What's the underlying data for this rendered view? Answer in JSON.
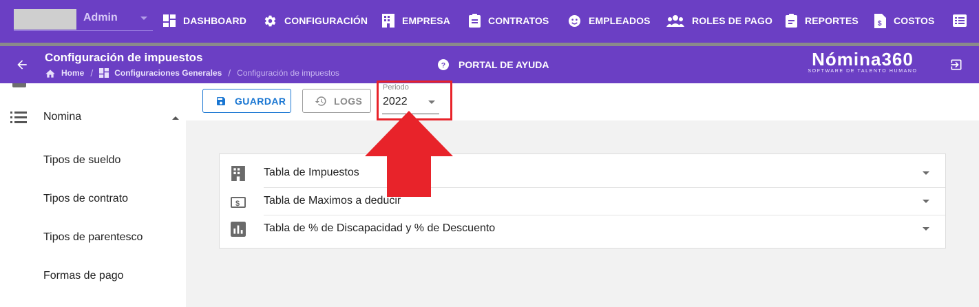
{
  "topbar": {
    "user_label": "Admin",
    "nav": [
      {
        "label": "DASHBOARD",
        "icon": "dashboard-icon"
      },
      {
        "label": "CONFIGURACIÓN",
        "icon": "gear-icon"
      },
      {
        "label": "EMPRESA",
        "icon": "building-icon"
      },
      {
        "label": "CONTRATOS",
        "icon": "clipboard-icon"
      },
      {
        "label": "EMPLEADOS",
        "icon": "face-icon"
      },
      {
        "label": "ROLES DE PAGO",
        "icon": "people-icon"
      },
      {
        "label": "REPORTES",
        "icon": "report-icon"
      },
      {
        "label": "COSTOS",
        "icon": "cost-file-icon"
      }
    ]
  },
  "header": {
    "title": "Configuración de impuestos",
    "breadcrumb": [
      "Home",
      "Configuraciones Generales",
      "Configuración de impuestos"
    ],
    "help_label": "PORTAL DE AYUDA",
    "brand_name": "Nómina360",
    "brand_tagline": "SOFTWARE DE TALENTO HUMANO"
  },
  "sidebar": {
    "group_label": "Nomina",
    "items": [
      "Tipos de sueldo",
      "Tipos de contrato",
      "Tipos de parentesco",
      "Formas de pago"
    ]
  },
  "toolbar": {
    "save_label": "GUARDAR",
    "logs_label": "LOGS",
    "period_label": "Periodo",
    "period_value": "2022"
  },
  "panels": [
    {
      "label": "Tabla de Impuestos",
      "icon": "building-icon"
    },
    {
      "label": "Tabla de Maximos a deducir",
      "icon": "money-icon"
    },
    {
      "label": "Tabla de % de Discapacidad y % de Descuento",
      "icon": "bar-chart-icon"
    }
  ],
  "colors": {
    "primary": "#6b3fc4",
    "accent": "#1976d2",
    "highlight": "#e8232a"
  }
}
